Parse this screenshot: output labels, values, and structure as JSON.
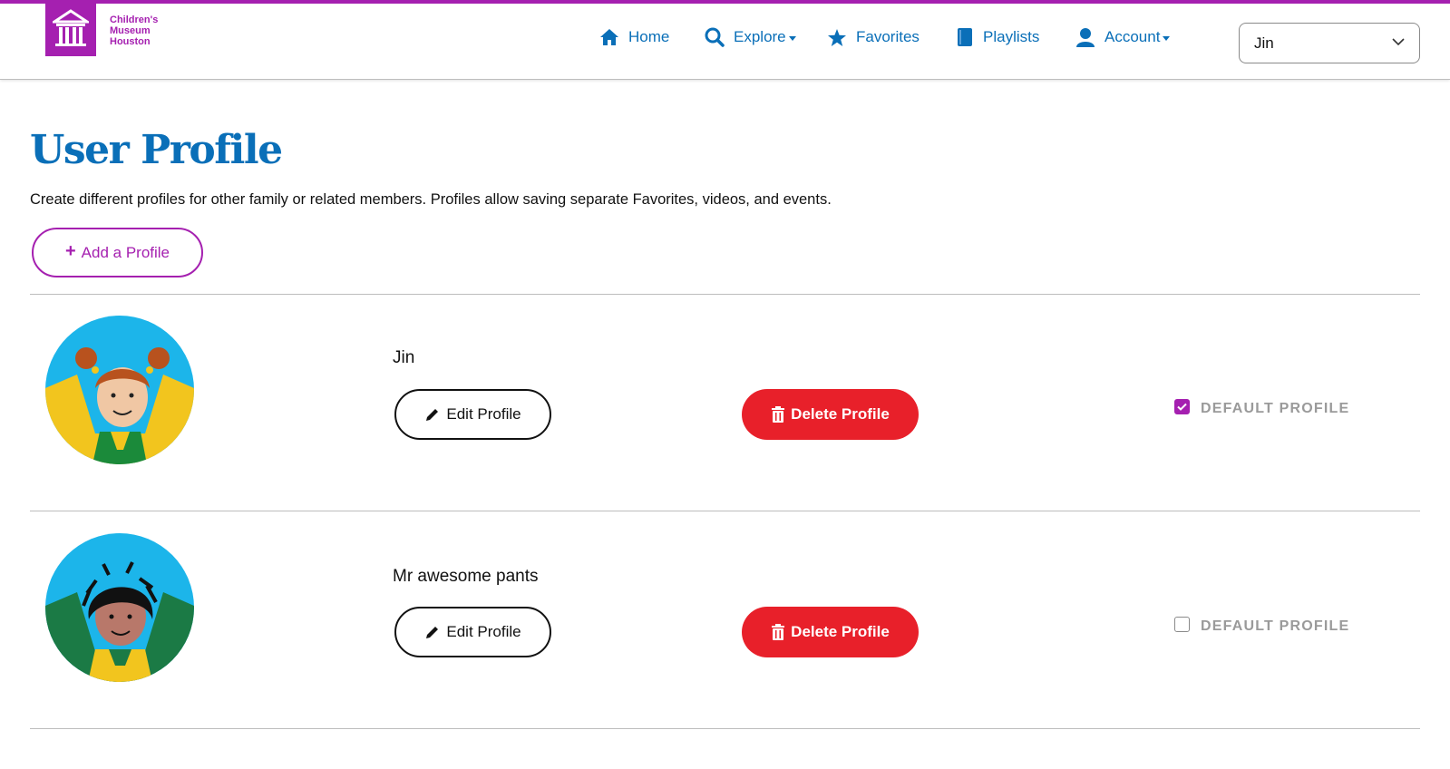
{
  "brand": {
    "name_line1": "Children's",
    "name_line2": "Museum",
    "name_line3": "Houston",
    "color": "#a520b0"
  },
  "nav": {
    "items": [
      {
        "label": "Home",
        "icon": "home-icon"
      },
      {
        "label": "Explore",
        "icon": "search-icon",
        "dropdown": true
      },
      {
        "label": "Favorites",
        "icon": "star-icon"
      },
      {
        "label": "Playlists",
        "icon": "book-icon"
      },
      {
        "label": "Account",
        "icon": "user-icon",
        "dropdown": true
      }
    ],
    "color": "#0a6fb8"
  },
  "profile_selector": {
    "value": "Jin"
  },
  "page": {
    "title": "User Profile",
    "intro": "Create different profiles for other family or related members. Profiles allow saving separate Favorites, videos, and events.",
    "add_button": "Add a Profile"
  },
  "profiles": [
    {
      "name": "Jin",
      "edit_label": "Edit Profile",
      "delete_label": "Delete Profile",
      "default_label": "DEFAULT PROFILE",
      "is_default": true
    },
    {
      "name": "Mr awesome pants",
      "edit_label": "Edit Profile",
      "delete_label": "Delete Profile",
      "default_label": "DEFAULT PROFILE",
      "is_default": false
    }
  ],
  "colors": {
    "accent_purple": "#a520b0",
    "link_blue": "#0a6fb8",
    "danger_red": "#e8202a"
  }
}
